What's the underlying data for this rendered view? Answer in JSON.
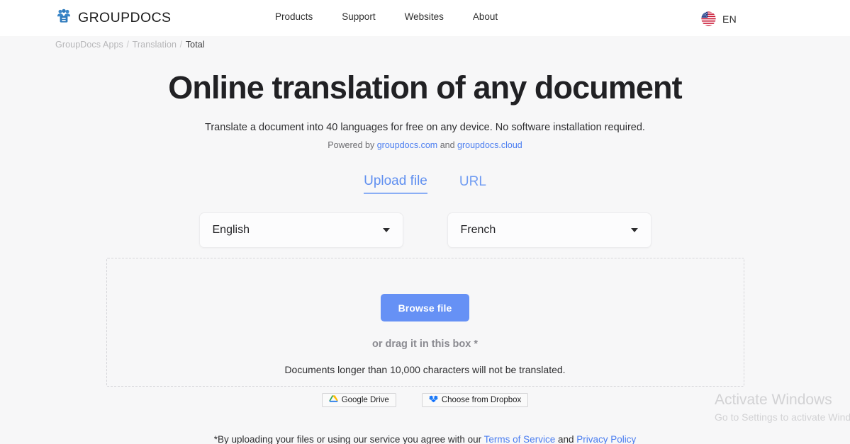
{
  "header": {
    "brand_name": "GROUPDOCS",
    "brand_icon": "group-people-icon",
    "nav": [
      {
        "label": "Products"
      },
      {
        "label": "Support"
      },
      {
        "label": "Websites"
      },
      {
        "label": "About"
      }
    ],
    "language": {
      "code": "EN",
      "flag_icon": "us-flag-icon"
    }
  },
  "breadcrumb": {
    "items": [
      {
        "label": "GroupDocs Apps",
        "current": false
      },
      {
        "label": "Translation",
        "current": false
      },
      {
        "label": "Total",
        "current": true
      }
    ],
    "separator": "/"
  },
  "main": {
    "title": "Online translation of any document",
    "subtitle": "Translate a document into 40 languages for free on any device. No software installation required.",
    "powered": {
      "prefix": "Powered by",
      "link1": "groupdocs.com",
      "middle": "and",
      "link2": "groupdocs.cloud"
    },
    "tabs": [
      {
        "label": "Upload file",
        "active": true
      },
      {
        "label": "URL",
        "active": false
      }
    ],
    "selects": {
      "source": {
        "value": "English",
        "caret_icon": "chevron-down-icon"
      },
      "target": {
        "value": "French",
        "caret_icon": "chevron-down-icon"
      }
    },
    "dropzone": {
      "browse_label": "Browse file",
      "drag_hint": "or drag it in this box *",
      "limit_note": "Documents longer than 10,000 characters will not be translated."
    },
    "cloud_buttons": [
      {
        "label": "Google Drive",
        "icon": "google-drive-icon"
      },
      {
        "label": "Choose from Dropbox",
        "icon": "dropbox-icon"
      }
    ],
    "disclaimer": {
      "prefix": "*By uploading your files or using our service you agree with our",
      "terms_link": "Terms of Service",
      "middle": "and",
      "privacy_link": "Privacy Policy"
    }
  },
  "watermark": {
    "title": "Activate Windows",
    "subtitle": "Go to Settings to activate Windows."
  },
  "colors": {
    "accent_blue": "#4a7df0",
    "button_blue": "#6691f5",
    "tab_blue": "#5f8ff0",
    "page_bg": "#f7f7f8",
    "header_bg": "#ffffff",
    "text_dark": "#212124",
    "text_muted": "#8a8a90",
    "breadcrumb_gray": "#b6b6b8",
    "dashed_border": "#d6d6da",
    "watermark_gray": "#d2d2d4"
  }
}
